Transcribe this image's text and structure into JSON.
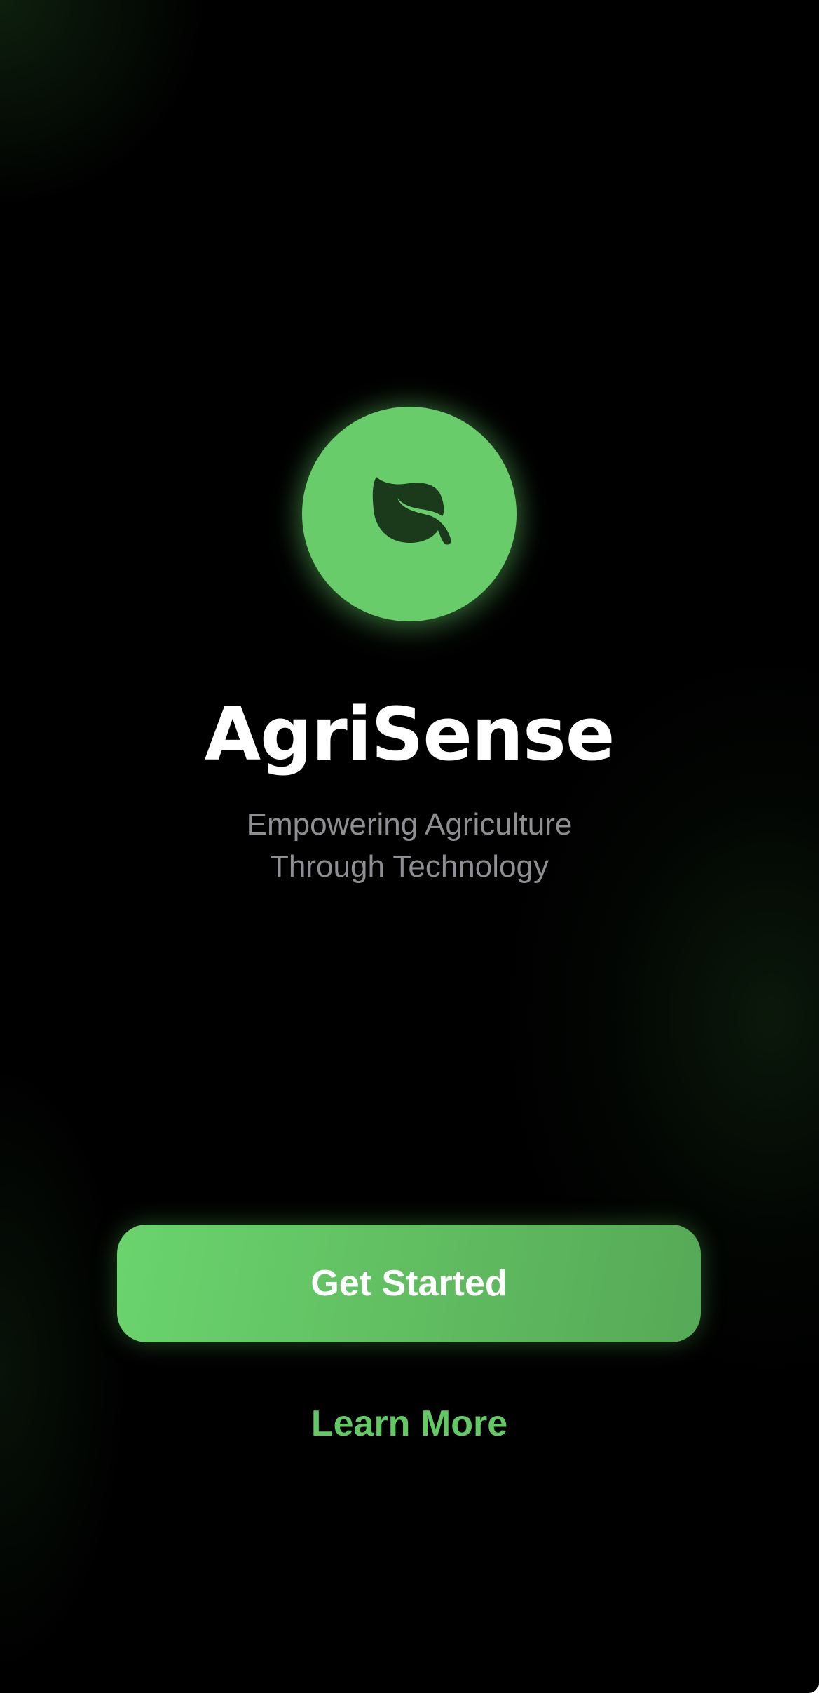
{
  "app": {
    "name": "AgriSense",
    "tagline_line1": "Empowering Agriculture",
    "tagline_line2": "Through Technology"
  },
  "logo": {
    "icon": "leaf-icon",
    "background_color": "#68cc6b",
    "icon_color": "#1b3a1c"
  },
  "actions": {
    "primary_label": "Get Started",
    "secondary_label": "Learn More"
  },
  "colors": {
    "background": "#000000",
    "accent": "#68cc6b",
    "text_primary": "#ffffff",
    "text_secondary": "#8e8e93"
  }
}
